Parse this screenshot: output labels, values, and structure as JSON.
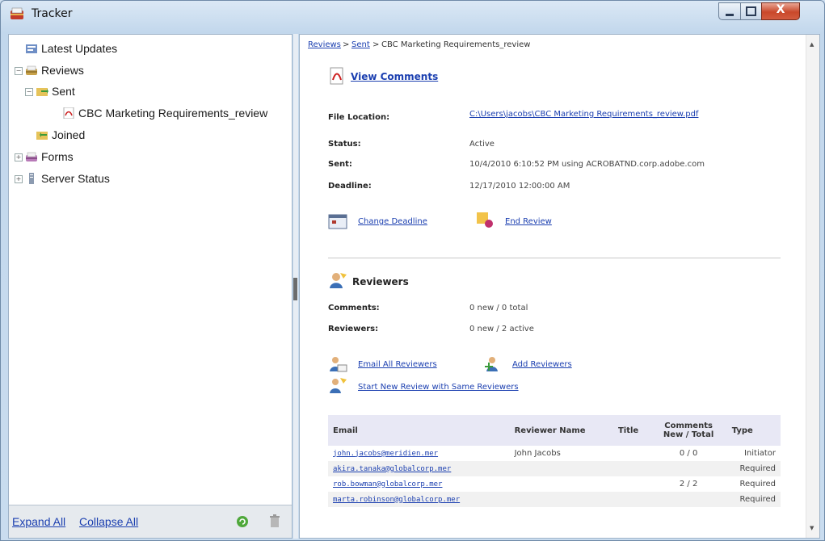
{
  "window": {
    "title": "Tracker",
    "close_glyph": "X"
  },
  "tree": {
    "items": [
      {
        "label": "Latest Updates",
        "icon": "updates-icon"
      },
      {
        "label": "Reviews",
        "icon": "reviews-folder-icon",
        "expander": "−"
      },
      {
        "label": "Sent",
        "icon": "sent-folder-icon",
        "expander": "−"
      },
      {
        "label": "CBC Marketing Requirements_review",
        "icon": "pdf-icon"
      },
      {
        "label": "Joined",
        "icon": "joined-folder-icon"
      },
      {
        "label": "Forms",
        "icon": "forms-folder-icon",
        "expander": "+"
      },
      {
        "label": "Server Status",
        "icon": "server-icon",
        "expander": "+"
      }
    ]
  },
  "footer": {
    "expand_all": "Expand All",
    "collapse_all": "Collapse All"
  },
  "breadcrumb": {
    "reviews": "Reviews",
    "sep1": ">",
    "sent": "Sent",
    "sep2": ">",
    "current": "CBC Marketing Requirements_review"
  },
  "detail": {
    "view_comments": "View Comments",
    "file_location_label": "File Location:",
    "file_location_value": "C:\\Users\\jacobs\\CBC Marketing Requirements_review.pdf",
    "status_label": "Status:",
    "status_value": "Active",
    "sent_label": "Sent:",
    "sent_value": "10/4/2010 6:10:52 PM using ACROBATND.corp.adobe.com",
    "deadline_label": "Deadline:",
    "deadline_value": "12/17/2010 12:00:00 AM",
    "change_deadline": "Change Deadline",
    "end_review": "End Review"
  },
  "reviewers": {
    "heading": "Reviewers",
    "comments_label": "Comments:",
    "comments_value": "0 new / 0 total",
    "reviewers_label": "Reviewers:",
    "reviewers_value": "0 new / 2 active",
    "email_all": "Email All Reviewers",
    "add_reviewers": "Add Reviewers",
    "start_new": "Start New Review with Same Reviewers"
  },
  "table": {
    "headers": {
      "email": "Email",
      "name": "Reviewer Name",
      "title": "Title",
      "comments": "Comments New / Total",
      "type": "Type"
    },
    "rows": [
      {
        "email": "john.jacobs@meridien.mer",
        "name": "John Jacobs",
        "title": "",
        "comments": "0 / 0",
        "type": "Initiator"
      },
      {
        "email": "akira.tanaka@globalcorp.mer",
        "name": "",
        "title": "",
        "comments": "",
        "type": "Required"
      },
      {
        "email": "rob.bowman@globalcorp.mer",
        "name": "",
        "title": "",
        "comments": "2 / 2",
        "type": "Required"
      },
      {
        "email": "marta.robinson@globalcorp.mer",
        "name": "",
        "title": "",
        "comments": "",
        "type": "Required"
      }
    ]
  },
  "colors": {
    "link": "#1b3fb0",
    "close_button": "#c9482b",
    "table_header": "#e8e8f5"
  }
}
